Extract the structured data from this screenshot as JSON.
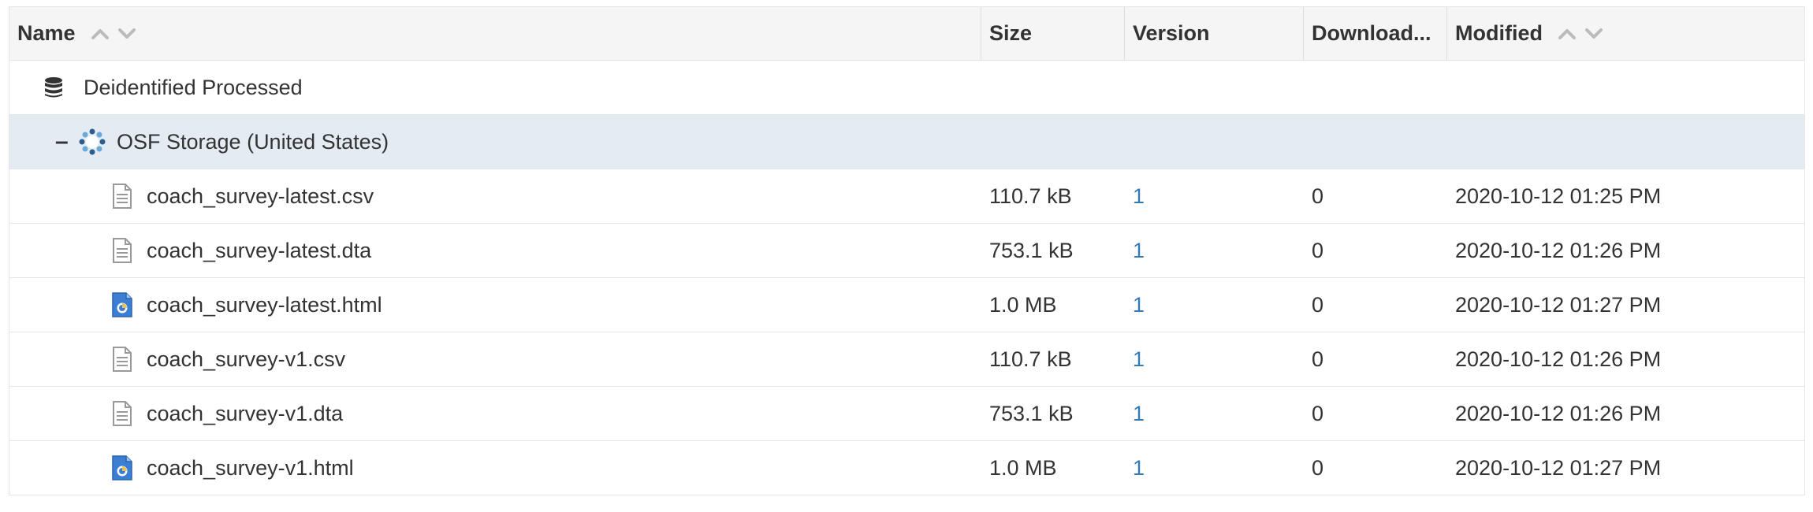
{
  "headers": {
    "name": "Name",
    "size": "Size",
    "version": "Version",
    "downloads": "Download...",
    "modified": "Modified"
  },
  "project": {
    "label": "Deidentified Processed",
    "icon": "database-icon"
  },
  "storage": {
    "label": "OSF Storage (United States)",
    "icon": "osf-storage-icon",
    "toggle": "–"
  },
  "files": [
    {
      "name": "coach_survey-latest.csv",
      "size": "110.7 kB",
      "version": "1",
      "downloads": "0",
      "modified": "2020-10-12 01:25 PM",
      "icon": "text-file-icon"
    },
    {
      "name": "coach_survey-latest.dta",
      "size": "753.1 kB",
      "version": "1",
      "downloads": "0",
      "modified": "2020-10-12 01:26 PM",
      "icon": "text-file-icon"
    },
    {
      "name": "coach_survey-latest.html",
      "size": "1.0 MB",
      "version": "1",
      "downloads": "0",
      "modified": "2020-10-12 01:27 PM",
      "icon": "html-file-icon"
    },
    {
      "name": "coach_survey-v1.csv",
      "size": "110.7 kB",
      "version": "1",
      "downloads": "0",
      "modified": "2020-10-12 01:26 PM",
      "icon": "text-file-icon"
    },
    {
      "name": "coach_survey-v1.dta",
      "size": "753.1 kB",
      "version": "1",
      "downloads": "0",
      "modified": "2020-10-12 01:26 PM",
      "icon": "text-file-icon"
    },
    {
      "name": "coach_survey-v1.html",
      "size": "1.0 MB",
      "version": "1",
      "downloads": "0",
      "modified": "2020-10-12 01:27 PM",
      "icon": "html-file-icon"
    }
  ],
  "colors": {
    "header_bg": "#f5f5f5",
    "selected_row_bg": "#e4ebf3",
    "link": "#337ab7"
  }
}
